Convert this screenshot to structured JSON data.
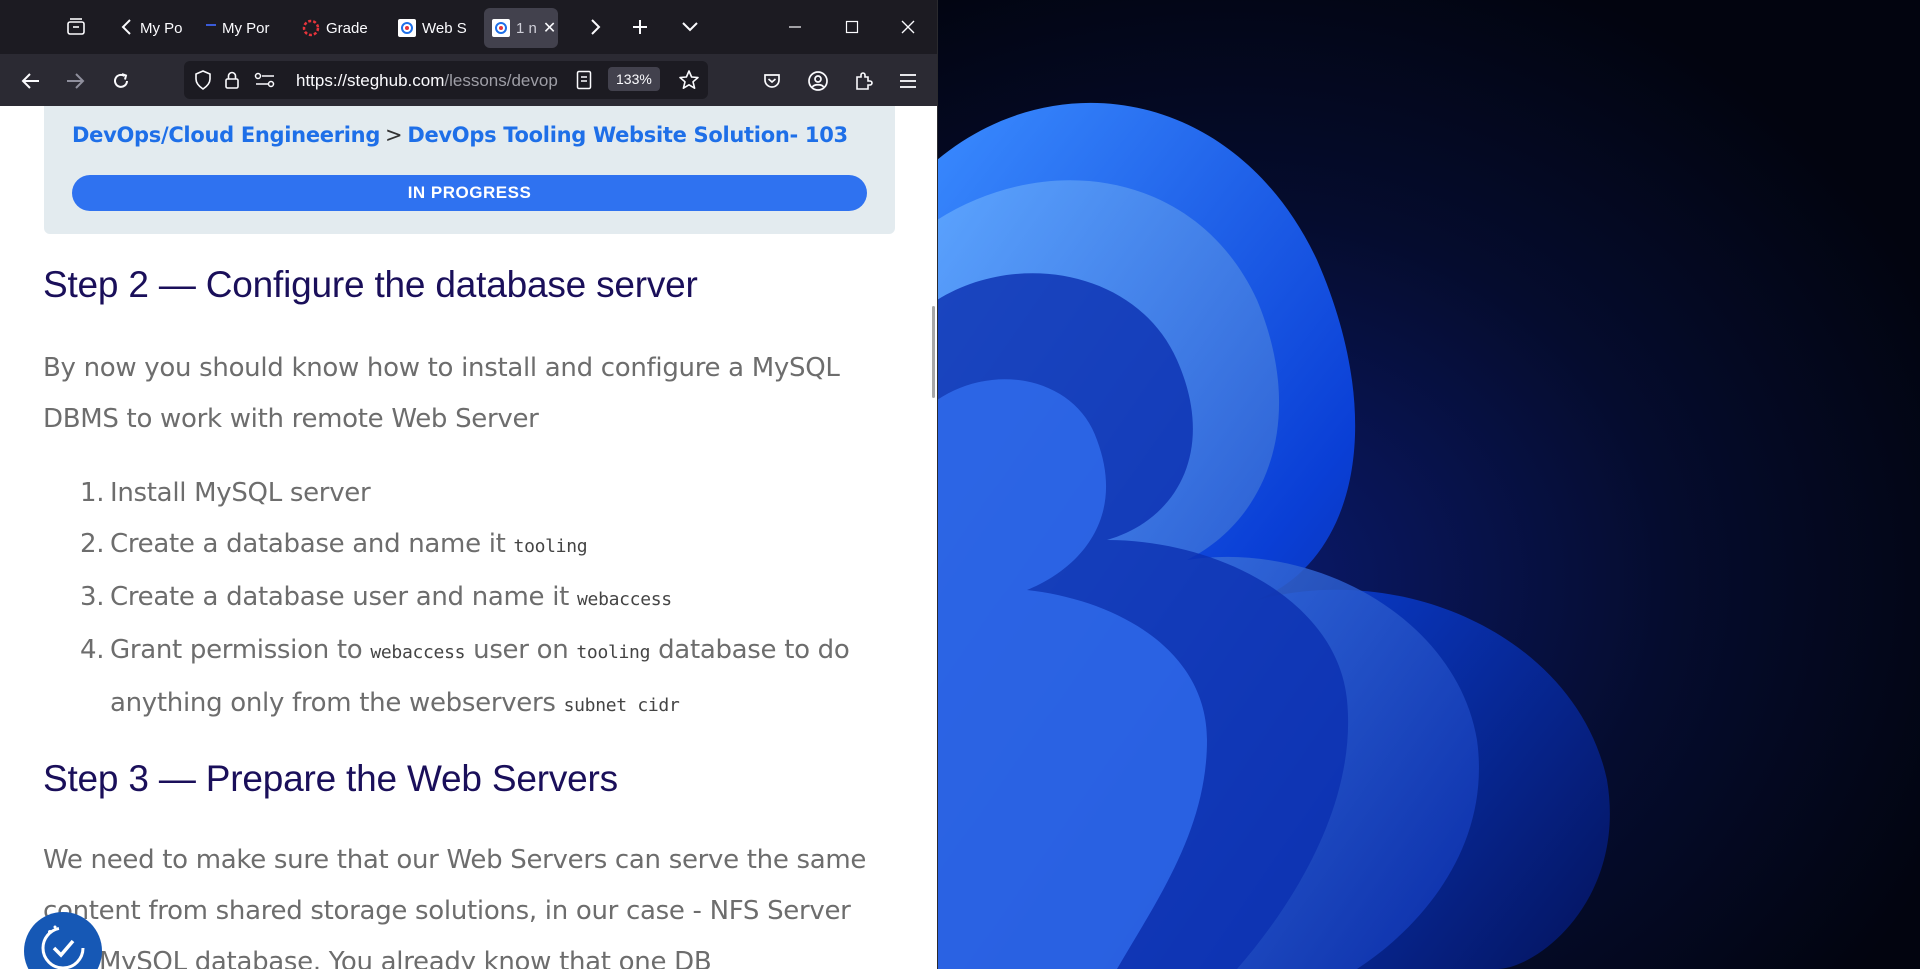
{
  "browser": {
    "tabs": [
      {
        "label": "My Po"
      },
      {
        "label": "My Por"
      },
      {
        "label": "Grade"
      },
      {
        "label": "Web S"
      },
      {
        "label": "1 n"
      }
    ],
    "url_main": "https://steghub.com",
    "url_path": "/lessons/devop",
    "zoom": "133%"
  },
  "breadcrumb": {
    "section": "DevOps/Cloud Engineering",
    "separator": ">",
    "lesson": "DevOps Tooling Website Solution- 103"
  },
  "status_button": "IN PROGRESS",
  "step2": {
    "heading": "Step 2 — Configure the database server",
    "intro": "By now you should know how to install and configure a MySQL DBMS to work with remote Web Server",
    "items": [
      {
        "num": "1.",
        "text": "Install MySQL server"
      },
      {
        "num": "2.",
        "text": "Create a database and name it ",
        "code": "tooling"
      },
      {
        "num": "3.",
        "text": "Create a database user and name it ",
        "code": "webaccess"
      },
      {
        "num": "4.",
        "text": "Grant permission to ",
        "code": "webaccess",
        "text2": " user on ",
        "code2": "tooling",
        "text3": " database to do anything only from the webservers ",
        "code3": "subnet cidr"
      }
    ]
  },
  "step3": {
    "heading": "Step 3 — Prepare the Web Servers",
    "intro": "We need to make sure that our Web Servers can serve the same content from shared storage solutions, in our case - NFS Server and MySQL database. You already know that one DB"
  }
}
